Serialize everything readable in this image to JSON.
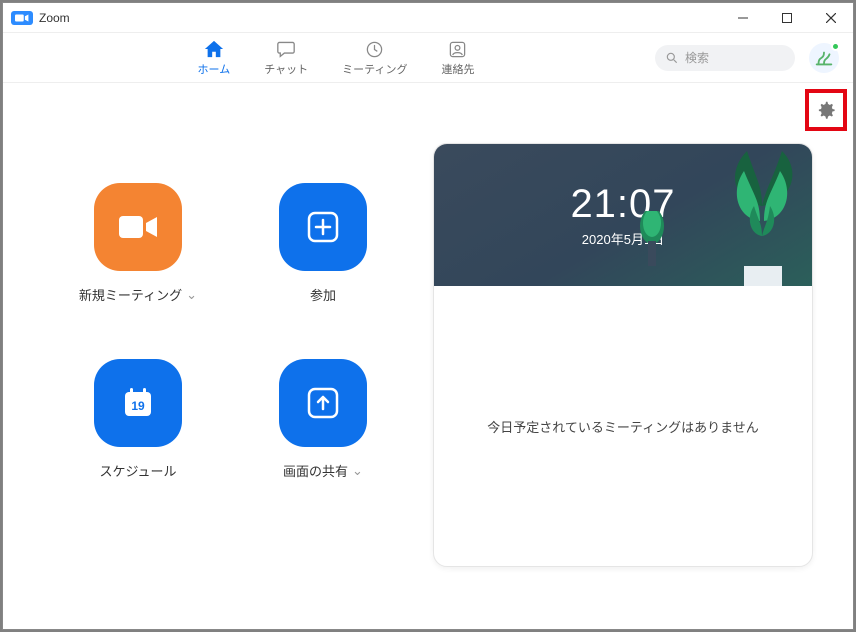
{
  "window": {
    "title": "Zoom"
  },
  "nav": {
    "home": "ホーム",
    "chat": "チャット",
    "meetings": "ミーティング",
    "contacts": "連絡先"
  },
  "search": {
    "placeholder": "検索"
  },
  "actions": {
    "new_meeting": "新規ミーティング",
    "join": "参加",
    "schedule": "スケジュール",
    "share_screen": "画面の共有",
    "schedule_day": "19"
  },
  "card": {
    "time": "21:07",
    "date": "2020年5月1日",
    "empty_message": "今日予定されているミーティングはありません"
  }
}
